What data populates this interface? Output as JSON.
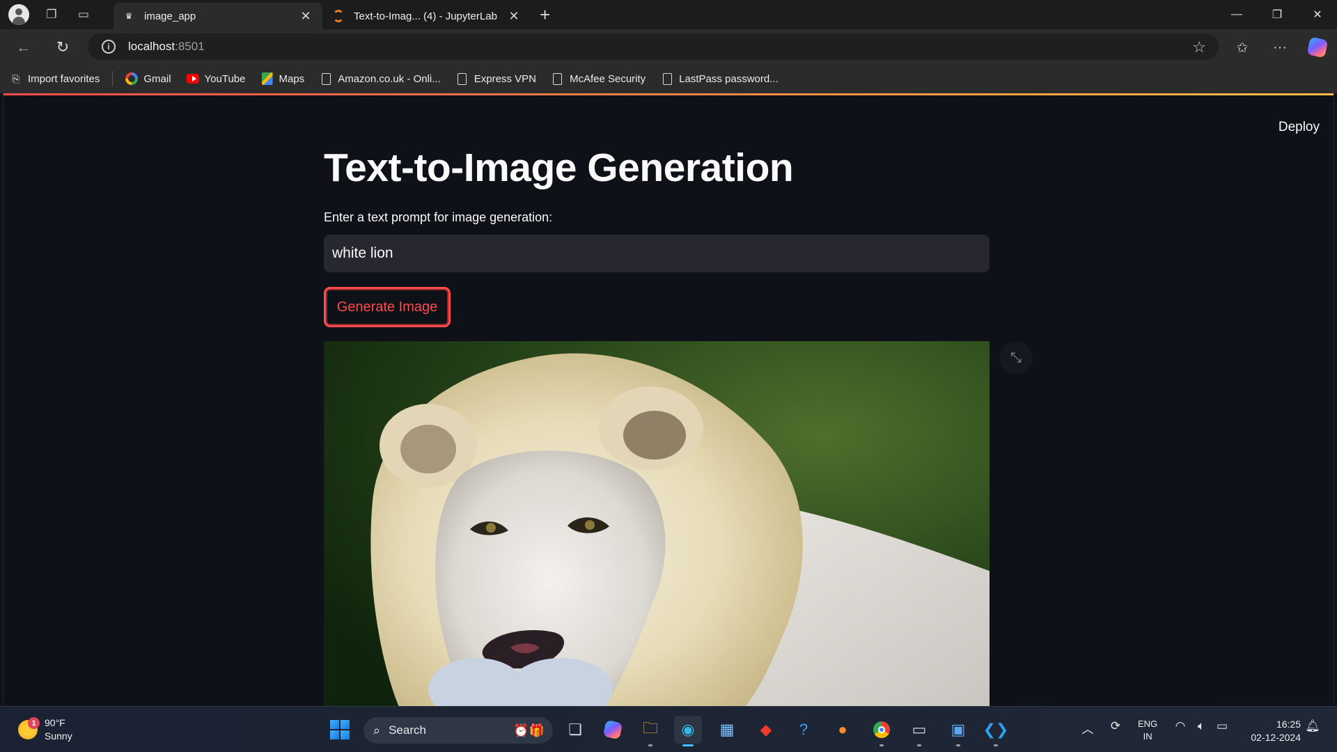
{
  "browser": {
    "tabs": [
      {
        "title": "image_app",
        "active": true,
        "favicon": "streamlit-crown-icon"
      },
      {
        "title": "Text-to-Imag... (4) - JupyterLab",
        "active": false,
        "favicon": "jupyter-icon"
      }
    ],
    "address": {
      "host": "localhost",
      "port": ":8501"
    },
    "bookmarks": [
      {
        "label": "Import favorites",
        "icon": "import-icon"
      },
      {
        "label": "Gmail",
        "icon": "google-icon"
      },
      {
        "label": "YouTube",
        "icon": "youtube-icon"
      },
      {
        "label": "Maps",
        "icon": "maps-icon"
      },
      {
        "label": "Amazon.co.uk - Onli...",
        "icon": "page-icon"
      },
      {
        "label": "Express VPN",
        "icon": "page-icon"
      },
      {
        "label": "McAfee Security",
        "icon": "page-icon"
      },
      {
        "label": "LastPass password...",
        "icon": "page-icon"
      }
    ]
  },
  "app": {
    "deploy_label": "Deploy",
    "title": "Text-to-Image Generation",
    "prompt_label": "Enter a text prompt for image generation:",
    "prompt_value": "white lion",
    "generate_label": "Generate Image",
    "image_subject": "white lion"
  },
  "taskbar": {
    "weather": {
      "temp": "90°F",
      "condition": "Sunny",
      "badge": "1"
    },
    "search_placeholder": "Search",
    "lang_line1": "ENG",
    "lang_line2": "IN",
    "time": "16:25",
    "date": "02-12-2024"
  },
  "colors": {
    "accent": "#ff4b4b",
    "page_bg": "#0e1117",
    "input_bg": "#262730"
  }
}
